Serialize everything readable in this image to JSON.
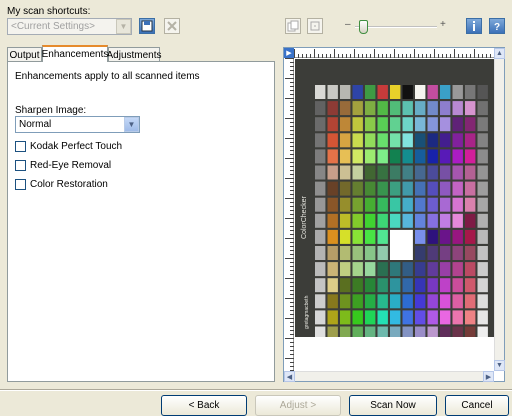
{
  "shortcuts": {
    "label": "My scan shortcuts:",
    "selected": "<Current Settings>"
  },
  "zoom": {
    "minus": "–",
    "plus": "+",
    "level": 0.1
  },
  "tabs": [
    {
      "label": "Output"
    },
    {
      "label": "Enhancements"
    },
    {
      "label": "Adjustments"
    }
  ],
  "enhancements": {
    "intro": "Enhancements apply to all scanned items",
    "sharpen_label": "Sharpen Image:",
    "sharpen_value": "Normal",
    "options": [
      {
        "label": "Kodak Perfect Touch",
        "checked": false
      },
      {
        "label": "Red-Eye Removal",
        "checked": false
      },
      {
        "label": "Color Restoration",
        "checked": false
      }
    ]
  },
  "preview": {
    "side_text": "ColorChecker",
    "side_text2": "gretagmacbeth",
    "colors": {
      "card_bg": "#3c3d39",
      "highlight": "#ffffff"
    }
  },
  "footer": {
    "back": "< Back",
    "adjust": "Adjust >",
    "scan_now": "Scan Now",
    "cancel": "Cancel"
  },
  "icons": {
    "save": "save-icon",
    "delete": "delete-icon",
    "copy": "copy-icon",
    "refresh": "refresh-icon",
    "info": "info-icon",
    "help": "help-icon"
  }
}
